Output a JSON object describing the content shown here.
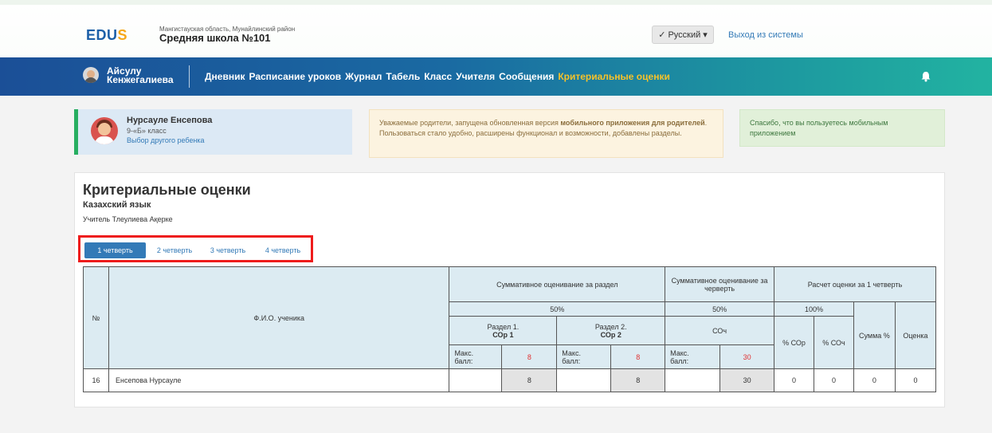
{
  "header": {
    "logo_main": "EDU",
    "logo_tail": "S",
    "region": "Мангистауская область, Мунайлинский район",
    "school": "Средняя школа №101",
    "language": "✓ Русский",
    "logout": "Выход из системы"
  },
  "nav": {
    "user_line1": "Айсулу",
    "user_line2": "Кенжегалиева",
    "items": [
      "Дневник",
      "Расписание уроков",
      "Журнал",
      "Табель",
      "Класс",
      "Учителя",
      "Сообщения",
      "Критериальные оценки"
    ],
    "active_index": 7
  },
  "student": {
    "name": "Нурсауле Енсепова",
    "class": "9-«Б» класс",
    "change": "Выбор другого ребенка"
  },
  "notice": {
    "part1": "Уважаемые родители, запущена обновленная версия ",
    "bold1": "мобильного приложения для родителей",
    "part2": ". Пользоваться стало удобно, расширены функционал и возможности, добавлены разделы."
  },
  "thanks": "Спасибо, что вы пользуетесь мобильным приложением",
  "main": {
    "title": "Критериальные оценки",
    "subject": "Казахский язык",
    "teacher": "Учитель Тлеулиева Ақерке",
    "quarters": [
      "1 четверть",
      "2 четверть",
      "3 четверть",
      "4 четверть"
    ],
    "active_quarter": 0
  },
  "table": {
    "col_no": "№",
    "col_name": "Ф.И.О. ученика",
    "sor_group": "Суммативное оценивание за раздел",
    "soch_group": "Суммативное оценивание за черверть",
    "calc_group": "Расчет оценки за 1 четверть",
    "sor_weight": "50%",
    "soch_weight": "50%",
    "calc_weight": "100%",
    "section1_line1": "Раздел 1.",
    "section1_line2": "СОр 1",
    "section2_line1": "Раздел 2.",
    "section2_line2": "СОр 2",
    "soch": "СОч",
    "pct_sor": "% СОр",
    "pct_soch": "% СОч",
    "sum_pct": "Сумма %",
    "grade": "Оценка",
    "max_label_1": "Макс.",
    "max_label_2": "балл:",
    "max_sor1": "8",
    "max_sor2": "8",
    "max_soch": "30",
    "rows": [
      {
        "no": "16",
        "name": "Енсепова Нурсауле",
        "sor1": "",
        "sor1_max": "8",
        "sor2": "",
        "sor2_max": "8",
        "soch": "",
        "soch_max": "30",
        "pct_sor": "0",
        "pct_soch": "0",
        "sum": "0",
        "grade": "0"
      }
    ]
  },
  "colors": {
    "accent": "#337ab7",
    "nav_active": "#f6c22a",
    "highlight_box": "#ee1c1c",
    "student_border": "#27ae60"
  }
}
